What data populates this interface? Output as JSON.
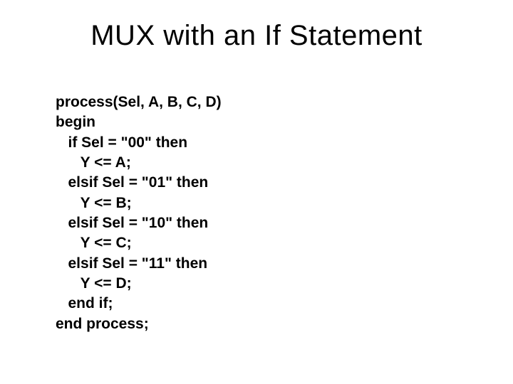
{
  "slide": {
    "title": "MUX with an If Statement",
    "code": "process(Sel, A, B, C, D)\nbegin\n   if Sel = \"00\" then\n      Y <= A;\n   elsif Sel = \"01\" then\n      Y <= B;\n   elsif Sel = \"10\" then\n      Y <= C;\n   elsif Sel = \"11\" then\n      Y <= D;\n   end if;\nend process;"
  }
}
